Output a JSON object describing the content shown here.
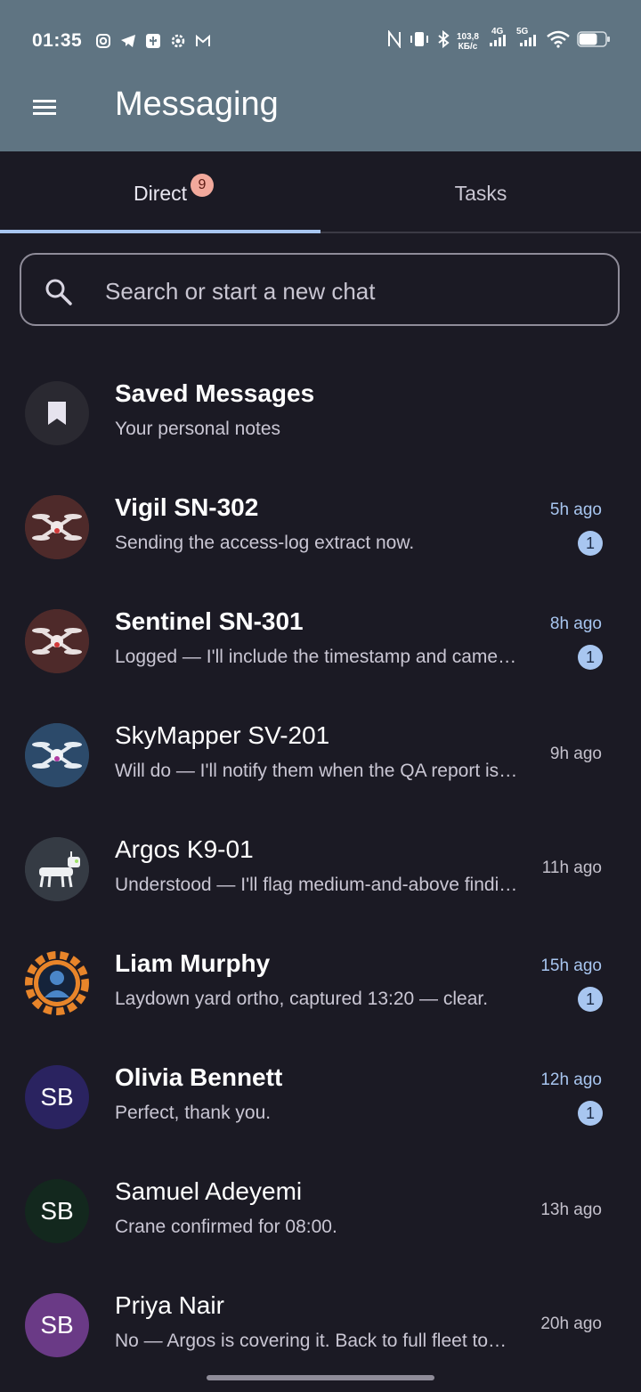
{
  "status_bar": {
    "time": "01:35",
    "net_speed_top": "103,8",
    "net_speed_bottom": "КБ/с",
    "sig1": "4G",
    "sig2": "5G"
  },
  "app_bar": {
    "title": "Messaging"
  },
  "tabs": [
    {
      "label": "Direct",
      "badge": "9",
      "selected": true
    },
    {
      "label": "Tasks",
      "selected": false
    }
  ],
  "search": {
    "placeholder": "Search or start a new chat"
  },
  "chats": [
    {
      "name": "Saved Messages",
      "preview": "Your personal notes",
      "time": "",
      "unread": "",
      "avatar": "bookmark-icon"
    },
    {
      "name": "Vigil SN-302",
      "preview": "Sending the access-log extract now.",
      "time": "5h ago",
      "unread": "1",
      "avatar": "drone-red-icon"
    },
    {
      "name": "Sentinel SN-301",
      "preview": "Logged — I'll include the timestamp and camera ID in the report.",
      "time": "8h ago",
      "unread": "1",
      "avatar": "drone-red-icon"
    },
    {
      "name": "SkyMapper SV-201",
      "preview": "Will do — I'll notify them when the QA report is ready.",
      "time": "9h ago",
      "unread": "",
      "avatar": "drone-blue-icon"
    },
    {
      "name": "Argos K9-01",
      "preview": "Understood — I'll flag medium-and-above findings.",
      "time": "11h ago",
      "unread": "",
      "avatar": "robot-dog-icon"
    },
    {
      "name": "Liam Murphy",
      "preview": "Laydown yard ortho, captured 13:20 — clear.",
      "time": "15h ago",
      "unread": "1",
      "avatar": "gear-profile-icon"
    },
    {
      "name": "Olivia Bennett",
      "preview": "Perfect, thank you.",
      "time": "12h ago",
      "unread": "1",
      "avatar_initials": "SB"
    },
    {
      "name": "Samuel Adeyemi",
      "preview": "Crane confirmed for 08:00.",
      "time": "13h ago",
      "unread": "",
      "avatar_initials": "SB"
    },
    {
      "name": "Priya Nair",
      "preview": "No — Argos is covering it. Back to full fleet tomorrow.",
      "time": "20h ago",
      "unread": "",
      "avatar_initials": "SB"
    }
  ],
  "colors": {
    "app_bar": "#5f7482",
    "background": "#1b1a24",
    "accent": "#a8c6f0",
    "badge": "#f2a99c"
  }
}
